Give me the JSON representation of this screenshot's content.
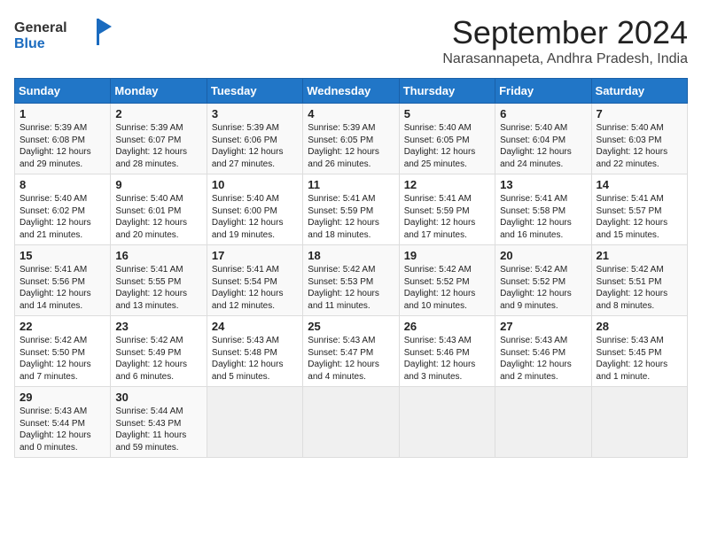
{
  "header": {
    "logo_line1": "General",
    "logo_line2": "Blue",
    "month": "September 2024",
    "location": "Narasannapeta, Andhra Pradesh, India"
  },
  "weekdays": [
    "Sunday",
    "Monday",
    "Tuesday",
    "Wednesday",
    "Thursday",
    "Friday",
    "Saturday"
  ],
  "weeks": [
    [
      {
        "day": "1",
        "lines": [
          "Sunrise: 5:39 AM",
          "Sunset: 6:08 PM",
          "Daylight: 12 hours",
          "and 29 minutes."
        ]
      },
      {
        "day": "2",
        "lines": [
          "Sunrise: 5:39 AM",
          "Sunset: 6:07 PM",
          "Daylight: 12 hours",
          "and 28 minutes."
        ]
      },
      {
        "day": "3",
        "lines": [
          "Sunrise: 5:39 AM",
          "Sunset: 6:06 PM",
          "Daylight: 12 hours",
          "and 27 minutes."
        ]
      },
      {
        "day": "4",
        "lines": [
          "Sunrise: 5:39 AM",
          "Sunset: 6:05 PM",
          "Daylight: 12 hours",
          "and 26 minutes."
        ]
      },
      {
        "day": "5",
        "lines": [
          "Sunrise: 5:40 AM",
          "Sunset: 6:05 PM",
          "Daylight: 12 hours",
          "and 25 minutes."
        ]
      },
      {
        "day": "6",
        "lines": [
          "Sunrise: 5:40 AM",
          "Sunset: 6:04 PM",
          "Daylight: 12 hours",
          "and 24 minutes."
        ]
      },
      {
        "day": "7",
        "lines": [
          "Sunrise: 5:40 AM",
          "Sunset: 6:03 PM",
          "Daylight: 12 hours",
          "and 22 minutes."
        ]
      }
    ],
    [
      {
        "day": "8",
        "lines": [
          "Sunrise: 5:40 AM",
          "Sunset: 6:02 PM",
          "Daylight: 12 hours",
          "and 21 minutes."
        ]
      },
      {
        "day": "9",
        "lines": [
          "Sunrise: 5:40 AM",
          "Sunset: 6:01 PM",
          "Daylight: 12 hours",
          "and 20 minutes."
        ]
      },
      {
        "day": "10",
        "lines": [
          "Sunrise: 5:40 AM",
          "Sunset: 6:00 PM",
          "Daylight: 12 hours",
          "and 19 minutes."
        ]
      },
      {
        "day": "11",
        "lines": [
          "Sunrise: 5:41 AM",
          "Sunset: 5:59 PM",
          "Daylight: 12 hours",
          "and 18 minutes."
        ]
      },
      {
        "day": "12",
        "lines": [
          "Sunrise: 5:41 AM",
          "Sunset: 5:59 PM",
          "Daylight: 12 hours",
          "and 17 minutes."
        ]
      },
      {
        "day": "13",
        "lines": [
          "Sunrise: 5:41 AM",
          "Sunset: 5:58 PM",
          "Daylight: 12 hours",
          "and 16 minutes."
        ]
      },
      {
        "day": "14",
        "lines": [
          "Sunrise: 5:41 AM",
          "Sunset: 5:57 PM",
          "Daylight: 12 hours",
          "and 15 minutes."
        ]
      }
    ],
    [
      {
        "day": "15",
        "lines": [
          "Sunrise: 5:41 AM",
          "Sunset: 5:56 PM",
          "Daylight: 12 hours",
          "and 14 minutes."
        ]
      },
      {
        "day": "16",
        "lines": [
          "Sunrise: 5:41 AM",
          "Sunset: 5:55 PM",
          "Daylight: 12 hours",
          "and 13 minutes."
        ]
      },
      {
        "day": "17",
        "lines": [
          "Sunrise: 5:41 AM",
          "Sunset: 5:54 PM",
          "Daylight: 12 hours",
          "and 12 minutes."
        ]
      },
      {
        "day": "18",
        "lines": [
          "Sunrise: 5:42 AM",
          "Sunset: 5:53 PM",
          "Daylight: 12 hours",
          "and 11 minutes."
        ]
      },
      {
        "day": "19",
        "lines": [
          "Sunrise: 5:42 AM",
          "Sunset: 5:52 PM",
          "Daylight: 12 hours",
          "and 10 minutes."
        ]
      },
      {
        "day": "20",
        "lines": [
          "Sunrise: 5:42 AM",
          "Sunset: 5:52 PM",
          "Daylight: 12 hours",
          "and 9 minutes."
        ]
      },
      {
        "day": "21",
        "lines": [
          "Sunrise: 5:42 AM",
          "Sunset: 5:51 PM",
          "Daylight: 12 hours",
          "and 8 minutes."
        ]
      }
    ],
    [
      {
        "day": "22",
        "lines": [
          "Sunrise: 5:42 AM",
          "Sunset: 5:50 PM",
          "Daylight: 12 hours",
          "and 7 minutes."
        ]
      },
      {
        "day": "23",
        "lines": [
          "Sunrise: 5:42 AM",
          "Sunset: 5:49 PM",
          "Daylight: 12 hours",
          "and 6 minutes."
        ]
      },
      {
        "day": "24",
        "lines": [
          "Sunrise: 5:43 AM",
          "Sunset: 5:48 PM",
          "Daylight: 12 hours",
          "and 5 minutes."
        ]
      },
      {
        "day": "25",
        "lines": [
          "Sunrise: 5:43 AM",
          "Sunset: 5:47 PM",
          "Daylight: 12 hours",
          "and 4 minutes."
        ]
      },
      {
        "day": "26",
        "lines": [
          "Sunrise: 5:43 AM",
          "Sunset: 5:46 PM",
          "Daylight: 12 hours",
          "and 3 minutes."
        ]
      },
      {
        "day": "27",
        "lines": [
          "Sunrise: 5:43 AM",
          "Sunset: 5:46 PM",
          "Daylight: 12 hours",
          "and 2 minutes."
        ]
      },
      {
        "day": "28",
        "lines": [
          "Sunrise: 5:43 AM",
          "Sunset: 5:45 PM",
          "Daylight: 12 hours",
          "and 1 minute."
        ]
      }
    ],
    [
      {
        "day": "29",
        "lines": [
          "Sunrise: 5:43 AM",
          "Sunset: 5:44 PM",
          "Daylight: 12 hours",
          "and 0 minutes."
        ]
      },
      {
        "day": "30",
        "lines": [
          "Sunrise: 5:44 AM",
          "Sunset: 5:43 PM",
          "Daylight: 11 hours",
          "and 59 minutes."
        ]
      },
      {
        "day": "",
        "lines": []
      },
      {
        "day": "",
        "lines": []
      },
      {
        "day": "",
        "lines": []
      },
      {
        "day": "",
        "lines": []
      },
      {
        "day": "",
        "lines": []
      }
    ]
  ]
}
